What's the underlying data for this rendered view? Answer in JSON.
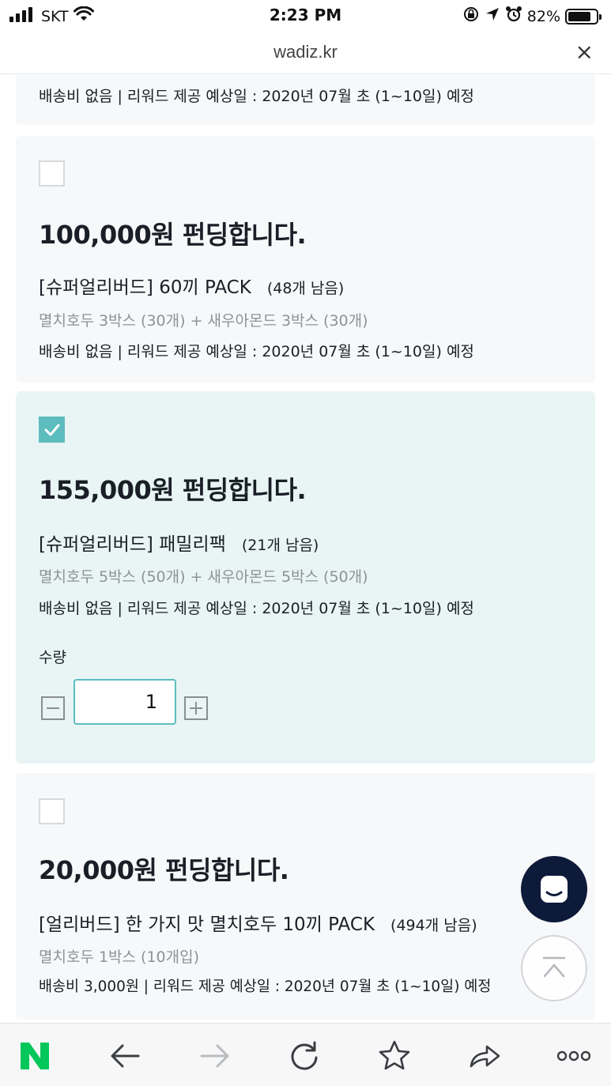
{
  "status_bar": {
    "carrier": "SKT",
    "time": "2:23 PM",
    "battery": "82%",
    "battery_level": 0.82,
    "icons": [
      "signal-icon",
      "wifi-icon",
      "screen-lock-icon",
      "location-icon",
      "alarm-icon",
      "battery-icon"
    ]
  },
  "browser": {
    "url": "wadiz.kr",
    "close_label": "×"
  },
  "colors": {
    "accent": "#5cbcbe",
    "selected_bg": "#e8f5f4",
    "card_bg": "#f7f8f9",
    "chat_fab": "#0e1a3a",
    "naver_green": "#03c75a"
  },
  "rewards": [
    {
      "shipping": "배송비 없음 | 리워드 제공 예상일 : 2020년 07월 초 (1~10일) 예정"
    },
    {
      "checked": false,
      "price": "100,000원 펀딩합니다.",
      "title": "[슈퍼얼리버드] 60끼 PACK",
      "remaining": "(48개 남음)",
      "description": "멸치호두 3박스 (30개) + 새우아몬드 3박스 (30개)",
      "shipping": "배송비 없음 | 리워드 제공 예상일 : 2020년 07월 초 (1~10일) 예정"
    },
    {
      "checked": true,
      "price": "155,000원 펀딩합니다.",
      "title": "[슈퍼얼리버드] 패밀리팩",
      "remaining": "(21개 남음)",
      "description": "멸치호두 5박스 (50개) + 새우아몬드 5박스 (50개)",
      "shipping": "배송비 없음 | 리워드 제공 예상일 : 2020년 07월 초 (1~10일) 예정",
      "quantity_label": "수량",
      "quantity_value": "1"
    },
    {
      "checked": false,
      "price": "20,000원 펀딩합니다.",
      "title": "[얼리버드] 한 가지 맛 멸치호두 10끼 PACK",
      "remaining": "(494개 남음)",
      "description": "멸치호두 1박스 (10개입)",
      "shipping": "배송비 3,000원 | 리워드 제공 예상일 : 2020년 07월 초 (1~10일) 예정"
    }
  ],
  "bottom_bar": {
    "items": [
      "naver-home-icon",
      "back-arrow-icon",
      "forward-arrow-icon",
      "reload-icon",
      "star-icon",
      "share-icon",
      "more-icon"
    ]
  }
}
